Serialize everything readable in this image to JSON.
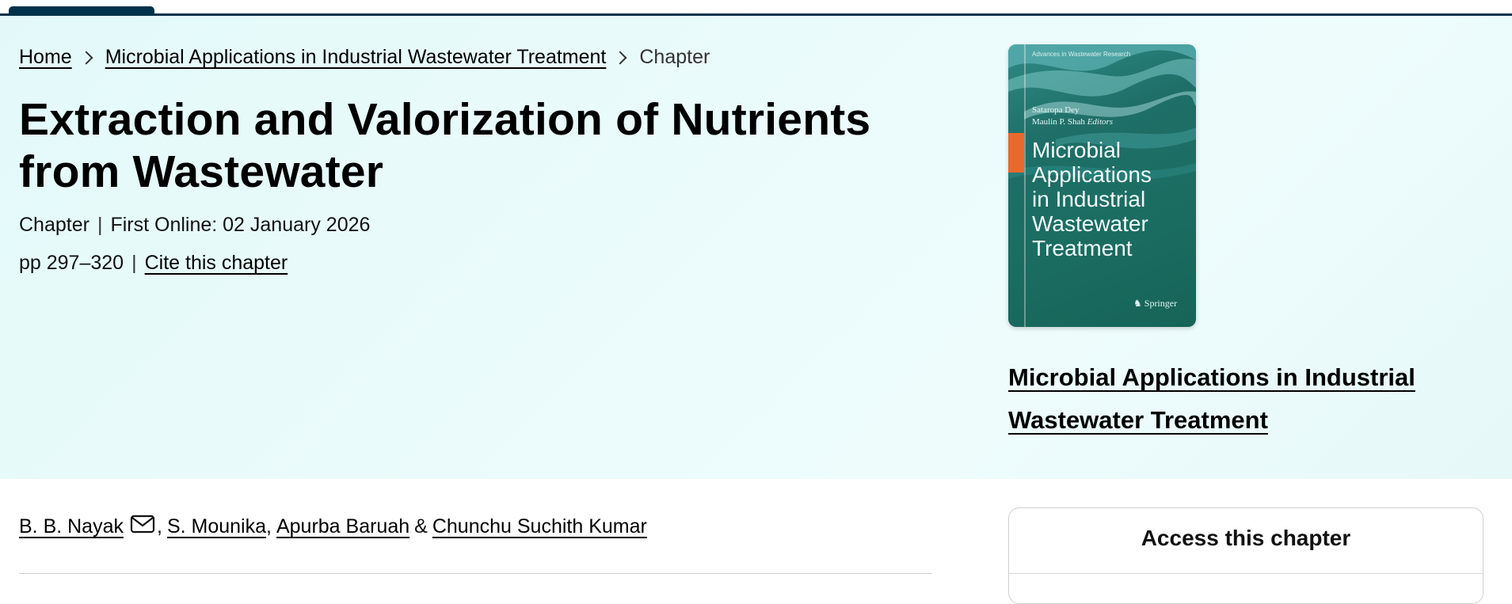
{
  "breadcrumb": {
    "home": "Home",
    "book": "Microbial Applications in Industrial Wastewater Treatment",
    "current": "Chapter"
  },
  "chapter": {
    "title": "Extraction and Valorization of Nutrients from Wastewater",
    "type": "Chapter",
    "first_online": "First Online: 02 January 2026",
    "pages": "pp 297–320",
    "cite_label": "Cite this chapter"
  },
  "cover": {
    "series": "Advances in Wastewater Research",
    "editor1": "Sataropa Dey",
    "editor2": "Maulin P. Shah",
    "editors_label": "Editors",
    "title_lines": [
      "Microbial",
      "Applications",
      "in Industrial",
      "Wastewater",
      "Treatment"
    ],
    "publisher": "Springer",
    "accent_color": "#e8692e",
    "base_color": "#1b6d62"
  },
  "book_link": "Microbial Applications in Industrial Wastewater Treatment",
  "authors": {
    "a1": "B. B. Nayak",
    "a2": "S. Mounika",
    "a3": "Apurba Baruah",
    "amp": "&",
    "a4": "Chunchu Suchith Kumar"
  },
  "access": {
    "heading": "Access this chapter"
  },
  "colors": {
    "hero_bg": "#e8fafa",
    "topbar": "#01324b"
  }
}
